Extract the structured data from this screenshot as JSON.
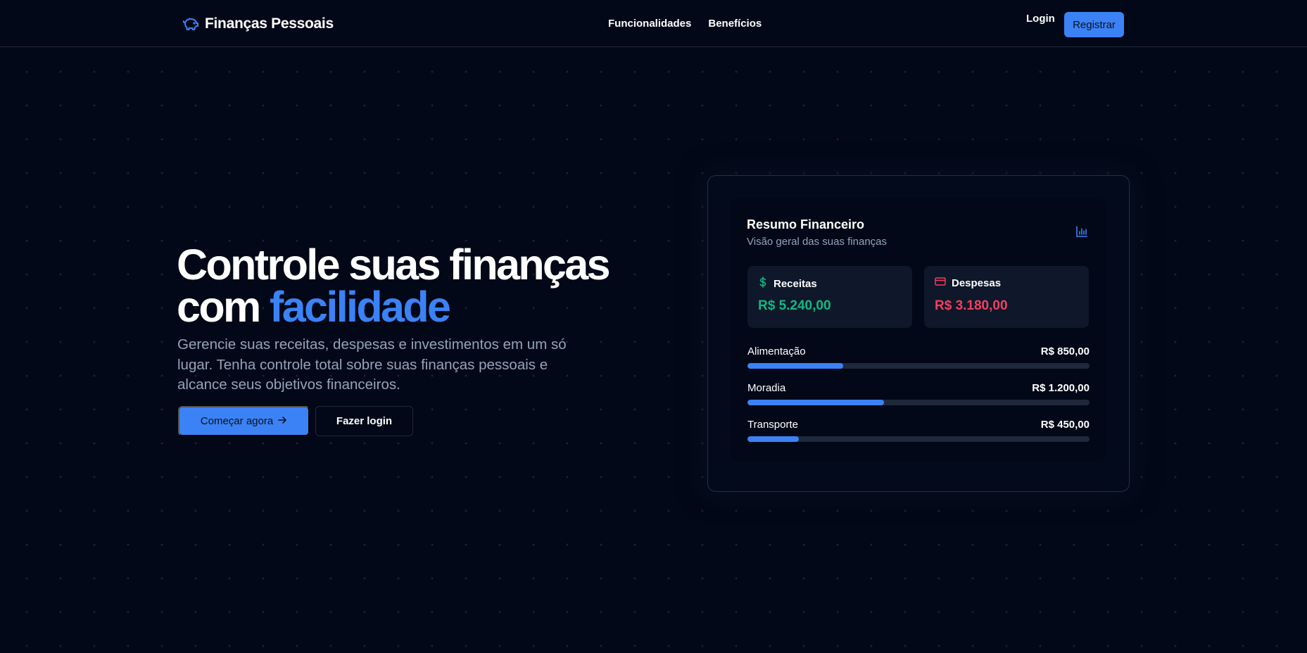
{
  "brand": {
    "name": "Finanças Pessoais",
    "icon": "piggy-bank-icon",
    "accent": "#3b82f6"
  },
  "nav": {
    "items": [
      "Funcionalidades",
      "Benefícios"
    ],
    "login": "Login",
    "register": "Registrar"
  },
  "hero": {
    "title_line1": "Controle suas finanças",
    "title_line2_prefix": "com ",
    "title_line2_accent": "facilidade",
    "subtitle": "Gerencie suas receitas, despesas e investimentos em um só lugar. Tenha controle total sobre suas finanças pessoais e alcance seus objetivos financeiros.",
    "cta_primary": "Começar agora",
    "cta_primary_icon": "arrow-right-icon",
    "cta_secondary": "Fazer login"
  },
  "summary": {
    "title": "Resumo Financeiro",
    "subtitle": "Visão geral das suas finanças",
    "header_icon": "bar-chart-icon",
    "income": {
      "label": "Receitas",
      "value": "R$ 5.240,00",
      "icon": "dollar-icon",
      "color": "#10b981"
    },
    "expense": {
      "label": "Despesas",
      "value": "R$ 3.180,00",
      "icon": "credit-card-icon",
      "color": "#f43f5e"
    },
    "categories": [
      {
        "name": "Alimentação",
        "amount": "R$ 850,00",
        "progress": 0.28
      },
      {
        "name": "Moradia",
        "amount": "R$ 1.200,00",
        "progress": 0.4
      },
      {
        "name": "Transporte",
        "amount": "R$ 450,00",
        "progress": 0.15
      }
    ]
  }
}
